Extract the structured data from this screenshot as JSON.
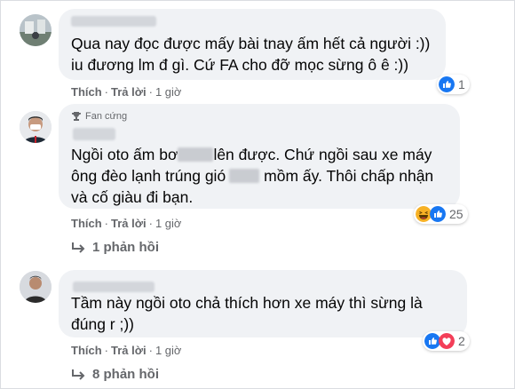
{
  "comments": [
    {
      "text": "Qua nay đọc được mấy bài tnay ấm hết cả người :)) iu đương lm đ gì. Cứ FA cho đỡ mọc sừng ô ê :))",
      "like_label": "Thích",
      "reply_label": "Trả lời",
      "time": "1 giờ",
      "reaction_count": "1"
    },
    {
      "badge": "Fan cứng",
      "text_part1": "Ngồi oto ấm bơ",
      "text_part2": "lên được. Chứ ngồi sau xe máy ông đèo lạnh trúng gió",
      "text_part3": "mồm ấy. Thôi chấp nhận và cố giàu đi bạn.",
      "like_label": "Thích",
      "reply_label": "Trả lời",
      "time": "1 giờ",
      "reaction_count": "25",
      "replies": "1 phản hồi"
    },
    {
      "text": "Tầm này ngồi oto chả thích hơn xe máy thì sừng là đúng r ;))",
      "like_label": "Thích",
      "reply_label": "Trả lời",
      "time": "1 giờ",
      "reaction_count": "2",
      "replies": "8 phản hồi"
    }
  ],
  "colors": {
    "bubble": "#f0f2f5",
    "meta_text": "#65676b",
    "like_blue": "#1877f2",
    "love_red": "#f33e58",
    "haha_yellow": "#f7b125"
  }
}
